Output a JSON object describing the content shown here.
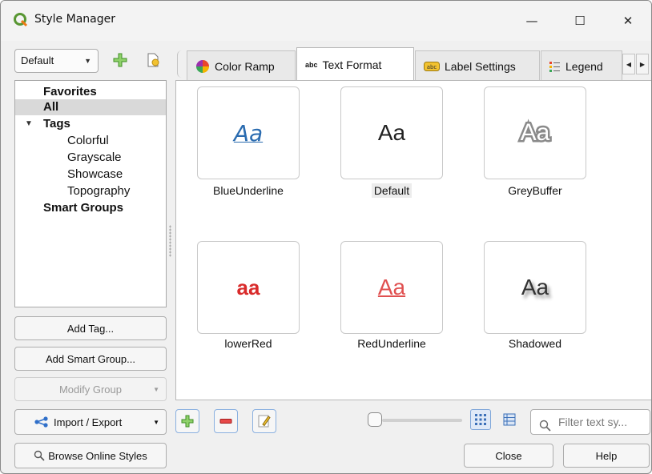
{
  "window": {
    "title": "Style Manager",
    "controls": {
      "minimize": "—",
      "maximize": "☐",
      "close": "✕"
    }
  },
  "left": {
    "combo_value": "Default",
    "tree": [
      {
        "label": "Favorites",
        "bold": true
      },
      {
        "label": "All",
        "bold": true,
        "selected": true
      },
      {
        "label": "Tags",
        "bold": true,
        "expanded": true
      },
      {
        "label": "Colorful"
      },
      {
        "label": "Grayscale"
      },
      {
        "label": "Showcase"
      },
      {
        "label": "Topography"
      },
      {
        "label": "Smart Groups",
        "bold": true
      }
    ],
    "buttons": {
      "add_tag": "Add Tag...",
      "add_smart_group": "Add Smart Group...",
      "modify_group": "Modify Group",
      "import_export": "Import / Export",
      "browse_online": "Browse Online Styles"
    }
  },
  "tabs": [
    {
      "label": "Color Ramp",
      "icon": "color-wheel-icon"
    },
    {
      "label": "Text Format",
      "icon": "abc-icon",
      "active": true
    },
    {
      "label": "Label Settings",
      "icon": "label-abc-icon"
    },
    {
      "label": "Legend",
      "icon": "legend-icon"
    }
  ],
  "tiles": [
    {
      "name": "BlueUnderline",
      "preview": "Aa"
    },
    {
      "name": "Default",
      "preview": "Aa",
      "selected": true
    },
    {
      "name": "GreyBuffer",
      "preview": "Aa"
    },
    {
      "name": "lowerRed",
      "preview": "aa"
    },
    {
      "name": "RedUnderline",
      "preview": "Aa"
    },
    {
      "name": "Shadowed",
      "preview": "Aa"
    }
  ],
  "bottom": {
    "filter_placeholder": "Filter text sy...",
    "close": "Close",
    "help": "Help"
  },
  "colors": {
    "accent_blue": "#2b6cb0",
    "red": "#d92b2b",
    "grey_buffer": "#8a8a8a",
    "selection": "#d9d9d9"
  }
}
